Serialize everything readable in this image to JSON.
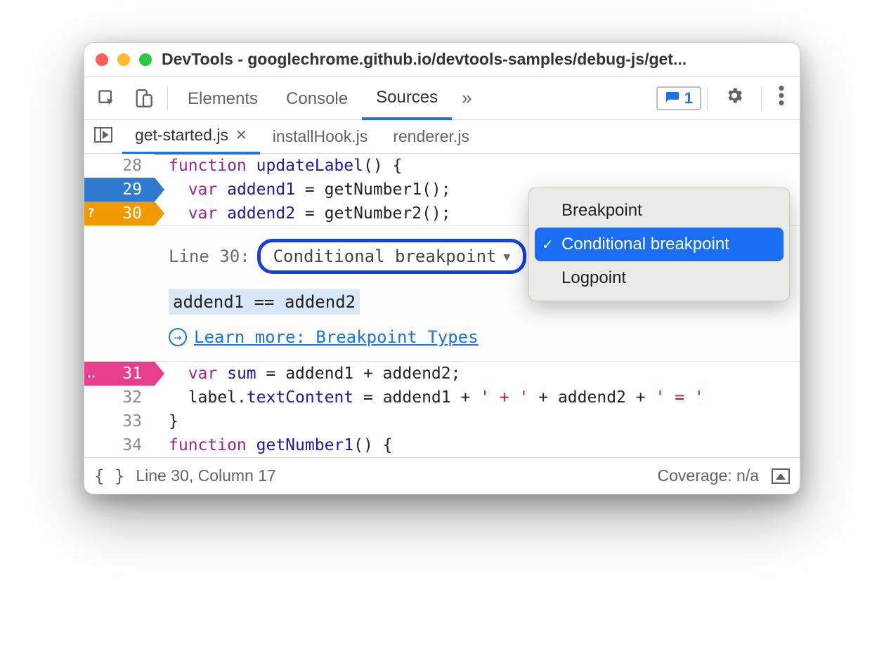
{
  "window": {
    "title": "DevTools - googlechrome.github.io/devtools-samples/debug-js/get..."
  },
  "toolbar": {
    "tabs": [
      "Elements",
      "Console",
      "Sources"
    ],
    "active_tab": "Sources",
    "issues_count": "1"
  },
  "file_tabs": {
    "items": [
      {
        "name": "get-started.js",
        "active": true
      },
      {
        "name": "installHook.js",
        "active": false
      },
      {
        "name": "renderer.js",
        "active": false
      }
    ]
  },
  "code": {
    "lines": {
      "28": {
        "num": "28"
      },
      "29": {
        "num": "29"
      },
      "30": {
        "num": "30",
        "mark": "?"
      },
      "31": {
        "num": "31",
        "mark": "‥"
      },
      "32": {
        "num": "32"
      },
      "33": {
        "num": "33"
      },
      "34": {
        "num": "34"
      }
    },
    "tokens": {
      "l28_kw": "function",
      "l28_fn": "updateLabel",
      "l28_rest": "() {",
      "l29_kw": "var",
      "l29_var": "addend1",
      "l29_eq": " = ",
      "l29_call": "getNumber1()",
      "l29_semi": ";",
      "l30_kw": "var",
      "l30_var": "addend2",
      "l30_eq": " = ",
      "l30_call": "getNumber2()",
      "l30_semi": ";",
      "l31_kw": "var",
      "l31_var": "sum",
      "l31_eq": " = ",
      "l31_expr": "addend1 + addend2",
      "l31_semi": ";",
      "l32_lhs": "label",
      "l32_dot": ".",
      "l32_prop": "textContent",
      "l32_eq": " = ",
      "l32_a": "addend1 + ",
      "l32_s1": "' + '",
      "l32_b": " + addend2 + ",
      "l32_s2": "' = '",
      "l33_brace": "}",
      "l34_kw": "function",
      "l34_fn": "getNumber1",
      "l34_rest": "() {"
    }
  },
  "breakpoint_editor": {
    "line_label": "Line 30:",
    "dropdown_value": "Conditional breakpoint",
    "condition": "addend1 == addend2",
    "learn_label": "Learn more: Breakpoint Types",
    "menu": {
      "options": [
        "Breakpoint",
        "Conditional breakpoint",
        "Logpoint"
      ],
      "selected": "Conditional breakpoint"
    }
  },
  "statusbar": {
    "position": "Line 30, Column 17",
    "coverage": "Coverage: n/a"
  }
}
